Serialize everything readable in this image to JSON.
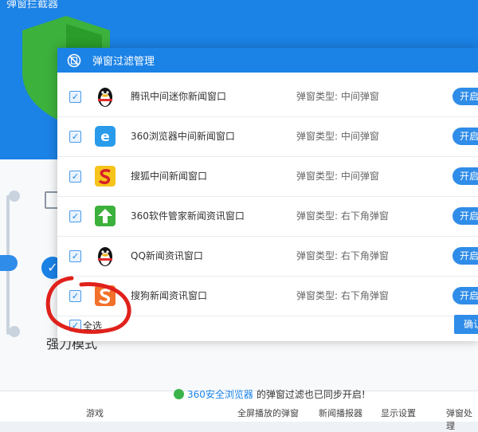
{
  "background": {
    "title": "弹窗拦截器",
    "mode_label": "强力模式",
    "notice": {
      "browser": "360安全浏览器",
      "text": "的弹窗过滤也已同步开启!"
    },
    "bottom_labels": [
      "游戏",
      "全屏播放的弹窗",
      "新闻播报器",
      "显示设置",
      "弹窗处理"
    ]
  },
  "dialog": {
    "title": "弹窗过滤管理",
    "rows": [
      {
        "name": "腾讯中间迷你新闻窗口",
        "type": "弹窗类型: 中间弹窗",
        "button": "开启",
        "icon": "penguin-icon"
      },
      {
        "name": "360浏览器中间新闻窗口",
        "type": "弹窗类型: 中间弹窗",
        "button": "开启",
        "icon": "browser-icon"
      },
      {
        "name": "搜狐中间新闻窗口",
        "type": "弹窗类型: 中间弹窗",
        "button": "开启",
        "icon": "sohu-icon"
      },
      {
        "name": "360软件管家新闻资讯窗口",
        "type": "弹窗类型: 右下角弹窗",
        "button": "开启",
        "icon": "upload-arrow-icon"
      },
      {
        "name": "QQ新闻资讯窗口",
        "type": "弹窗类型: 右下角弹窗",
        "button": "开启",
        "icon": "penguin-icon"
      },
      {
        "name": "搜狗新闻资讯窗口",
        "type": "弹窗类型: 右下角弹窗",
        "button": "开启",
        "icon": "sogou-icon"
      }
    ],
    "select_all": "全选",
    "confirm": "确认"
  },
  "colors": {
    "accent": "#1b82e6",
    "annotation": "#e0211b"
  }
}
